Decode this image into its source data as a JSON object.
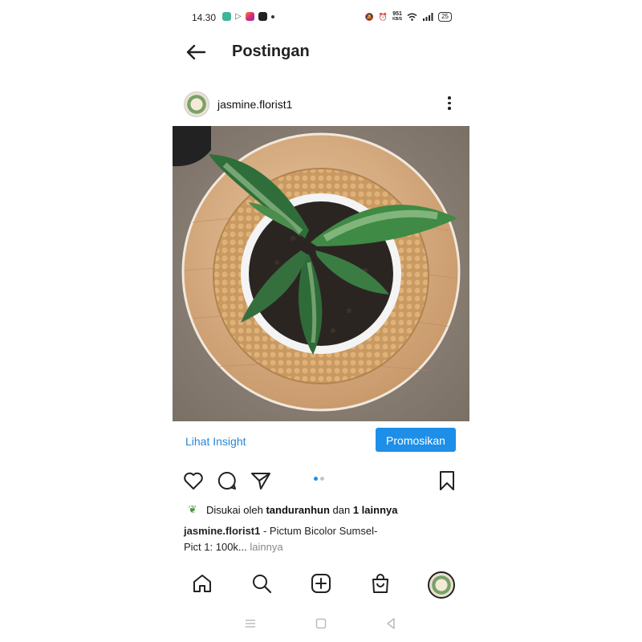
{
  "status_bar": {
    "time": "14.30",
    "net_speed_top": "951",
    "net_speed_unit": "KB/S",
    "battery": "25"
  },
  "header": {
    "title": "Postingan"
  },
  "post": {
    "username": "jasmine.florist1",
    "insight_link": "Lihat Insight",
    "promote_button": "Promosikan",
    "carousel": {
      "count": 2,
      "active_index": 0
    },
    "likes": {
      "prefix": "Disukai oleh",
      "user": "tanduranhun",
      "connector": "dan",
      "others": "1 lainnya"
    },
    "caption": {
      "username": "jasmine.florist1",
      "text": " - Pictum Bicolor Sumsel-",
      "line2": "Pict 1: 100k...",
      "more": "lainnya"
    }
  },
  "colors": {
    "accent": "#1d8fe8",
    "link": "#2a86d6"
  },
  "icons": {
    "back": "arrow-left-icon",
    "like": "heart-icon",
    "comment": "comment-icon",
    "share": "send-icon",
    "save": "bookmark-icon",
    "home": "home-icon",
    "search": "search-icon",
    "create": "plus-square-icon",
    "shop": "shopping-bag-icon"
  }
}
